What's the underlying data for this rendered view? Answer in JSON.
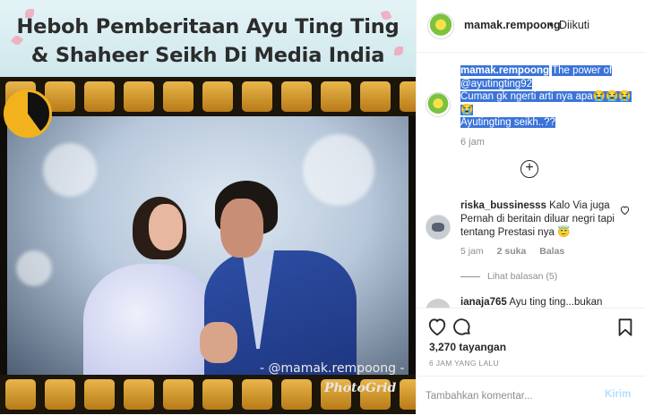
{
  "media": {
    "banner_title": "Heboh Pemberitaan Ayu Ting Ting\n& Shaheer Seikh Di Media India",
    "watermark": "- @mamak.rempoong -",
    "photogrid": "PhotoGrid"
  },
  "header": {
    "username": "mamak.rempoong",
    "separator": "•",
    "follow_status": "Diikuti"
  },
  "caption": {
    "username": "mamak.rempoong",
    "lines": [
      "The power of",
      "@ayutingting92",
      "Cuman gk ngerti arti nya apa😭😭😭",
      "😭",
      "Ayutingting seikh..??"
    ],
    "time": "6 jam"
  },
  "comments": [
    {
      "username": "riska_bussinesss",
      "text": "Kalo Via juga Pernah di beritain diluar negri tapi tentang Prestasi nya 😇",
      "time": "5 jam",
      "likes": "2 suka",
      "reply_label": "Balas",
      "view_replies": "Lihat balasan (5)"
    },
    {
      "username": "ianaja765",
      "text": "Ayu ting ting...bukan"
    }
  ],
  "stats": {
    "views": "3,270 tayangan",
    "posted": "6 JAM YANG LALU"
  },
  "composer": {
    "placeholder": "Tambahkan komentar...",
    "post_label": "Kirim"
  },
  "colors": {
    "highlight": "#3b74d8",
    "post_button_disabled": "#b2dffc"
  },
  "icons": [
    "heart-icon",
    "comment-icon",
    "bookmark-icon",
    "plus-circle-icon"
  ]
}
